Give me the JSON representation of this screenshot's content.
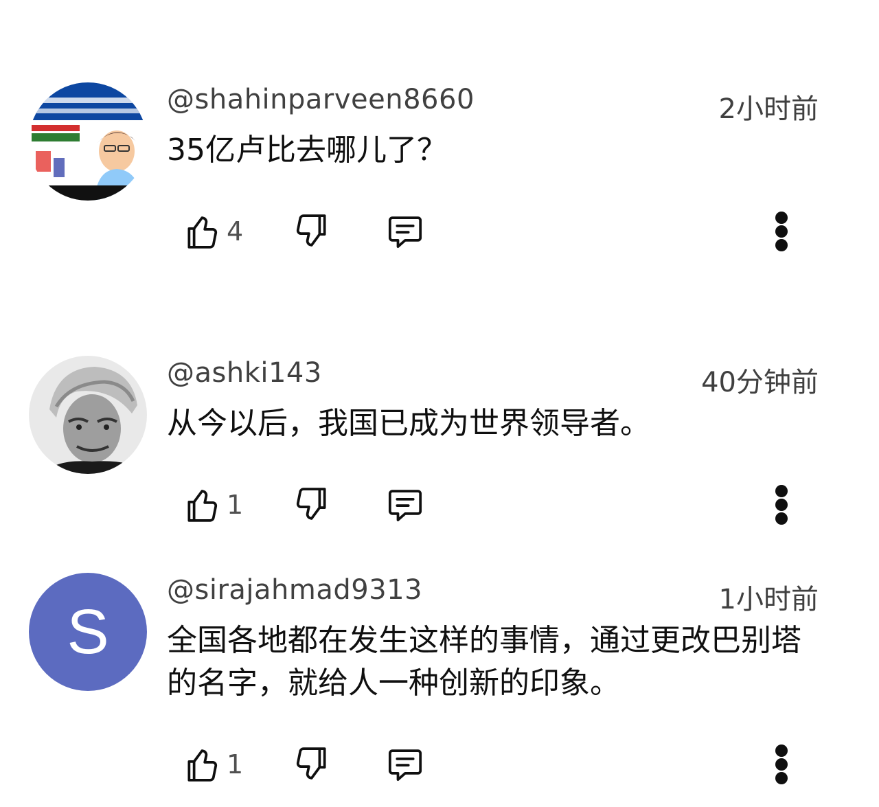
{
  "comments": [
    {
      "username": "@shahinparveen8660",
      "time": "2小时前",
      "text": "35亿卢比去哪儿了？",
      "likes": "4",
      "avatar": {
        "type": "image",
        "description_icon": "thumbnail-avatar"
      }
    },
    {
      "username": "@ashki143",
      "time": "40分钟前",
      "text": "从今以后，我国已成为世界领导者。",
      "likes": "1",
      "avatar": {
        "type": "image",
        "description_icon": "portrait-avatar"
      }
    },
    {
      "username": "@sirajahmad9313",
      "time": "1小时前",
      "text": "全国各地都在发生这样的事情，通过更改巴别塔的名字，就给人一种创新的印象。",
      "likes": "1",
      "avatar": {
        "type": "letter",
        "letter": "S",
        "color": "#5c6bc0"
      }
    }
  ],
  "icons": {
    "like": "thumbs-up-icon",
    "dislike": "thumbs-down-icon",
    "reply": "reply-comment-icon",
    "more": "more-vertical-icon"
  },
  "colors": {
    "text": "#0f0f0f",
    "meta": "#404040",
    "letter_avatar": "#5c6bc0"
  }
}
